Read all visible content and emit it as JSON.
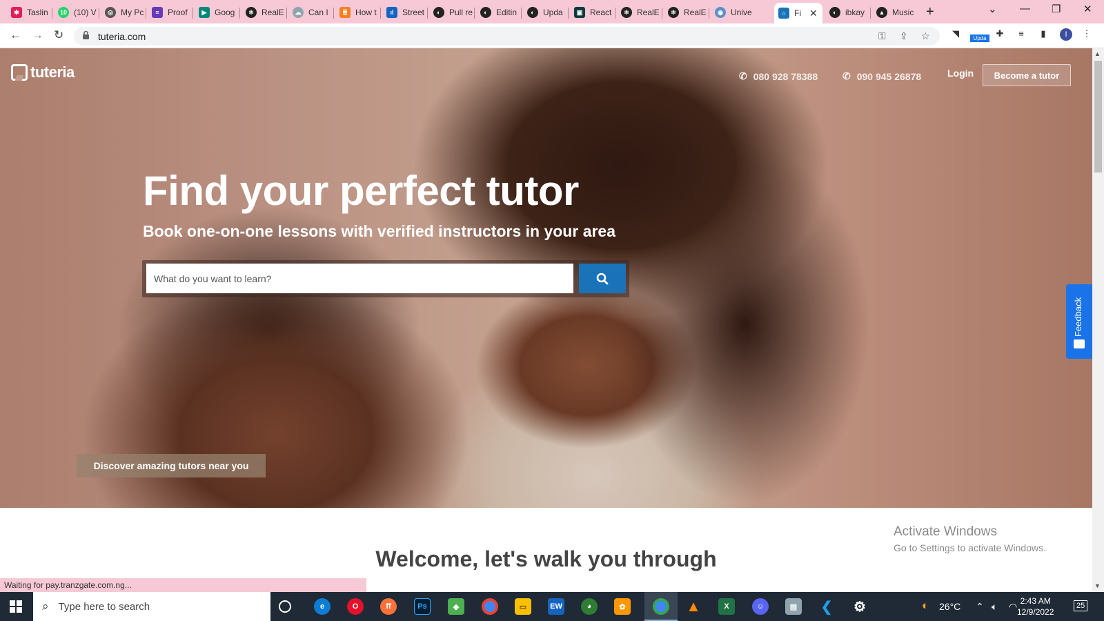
{
  "browser": {
    "tabs": [
      {
        "label": "Taslin",
        "icon": "slack-icon",
        "color": "#e01e5a"
      },
      {
        "label": "(10) V",
        "icon": "whatsapp-icon",
        "color": "#25d366"
      },
      {
        "label": "My Pc",
        "icon": "globe-icon",
        "color": "#555555"
      },
      {
        "label": "Proof",
        "icon": "form-icon",
        "color": "#673ab7"
      },
      {
        "label": "Goog",
        "icon": "meet-icon",
        "color": "#00897b"
      },
      {
        "label": "RealE",
        "icon": "react-icon",
        "color": "#222222"
      },
      {
        "label": "Can I",
        "icon": "cloud-icon",
        "color": "#90a4ae"
      },
      {
        "label": "How t",
        "icon": "stackoverflow-icon",
        "color": "#f48024"
      },
      {
        "label": "Street",
        "icon": "chart-icon",
        "color": "#1565c0"
      },
      {
        "label": "Pull re",
        "icon": "github-icon",
        "color": "#222222"
      },
      {
        "label": "Editin",
        "icon": "github-icon",
        "color": "#222222"
      },
      {
        "label": "Upda",
        "icon": "github-icon",
        "color": "#222222"
      },
      {
        "label": "React",
        "icon": "codesandbox-icon",
        "color": "#0d3b3b"
      },
      {
        "label": "RealE",
        "icon": "react-icon",
        "color": "#222222"
      },
      {
        "label": "RealE",
        "icon": "react-icon",
        "color": "#222222"
      },
      {
        "label": "Unive",
        "icon": "globe-icon",
        "color": "#5c8fc7"
      },
      {
        "label": "Fi",
        "icon": "tuteria-icon",
        "color": "#1a73b9",
        "active": true
      },
      {
        "label": "ibkay",
        "icon": "github-icon",
        "color": "#222222"
      },
      {
        "label": "Music",
        "icon": "music-icon",
        "color": "#222222"
      }
    ],
    "url": "tuteria.com",
    "profile_initial": "I",
    "update_badge": "Upda",
    "status_text": "Waiting for pay.tranzgate.com.ng..."
  },
  "page": {
    "logo_text": "tuteria",
    "phone_1": "080 928 78388",
    "phone_2": "090 945 26878",
    "login_label": "Login",
    "become_tutor_label": "Become a tutor",
    "headline": "Find your perfect tutor",
    "subheadline": "Book one-on-one lessons with verified instructors in your area",
    "search_placeholder": "What do you want to learn?",
    "discover_label": "Discover amazing tutors near you",
    "welcome_heading": "Welcome, let's walk you through",
    "feedback_label": "Feedback"
  },
  "watermark": {
    "line1": "Activate Windows",
    "line2": "Go to Settings to activate Windows."
  },
  "taskbar": {
    "search_placeholder": "Type here to search",
    "weather": "26°C",
    "time": "2:43 AM",
    "date": "12/9/2022",
    "notification_count": "25",
    "apps": [
      {
        "name": "task-view-icon",
        "color": "#1f2a36"
      },
      {
        "name": "edge-icon",
        "color": "#0c7cd5"
      },
      {
        "name": "opera-icon",
        "color": "#e5112b"
      },
      {
        "name": "firefox-icon",
        "color": "#ff7139"
      },
      {
        "name": "photoshop-icon",
        "color": "#001e36"
      },
      {
        "name": "layers-icon",
        "color": "#4caf50"
      },
      {
        "name": "chrome-icon",
        "color": "#4285f4"
      },
      {
        "name": "file-explorer-icon",
        "color": "#f8c000"
      },
      {
        "name": "ew-icon",
        "color": "#1565c0"
      },
      {
        "name": "globe-app-icon",
        "color": "#2e7d32"
      },
      {
        "name": "paint-app-icon",
        "color": "#ff9800"
      },
      {
        "name": "chrome-profile-icon",
        "color": "#4285f4"
      },
      {
        "name": "vlc-icon",
        "color": "#ff8800"
      },
      {
        "name": "excel-icon",
        "color": "#217346"
      },
      {
        "name": "discord-icon",
        "color": "#5865f2"
      },
      {
        "name": "monitor-app-icon",
        "color": "#90a4ae"
      },
      {
        "name": "vscode-icon",
        "color": "#007acc"
      },
      {
        "name": "settings-icon",
        "color": "#1f2a36"
      }
    ]
  }
}
